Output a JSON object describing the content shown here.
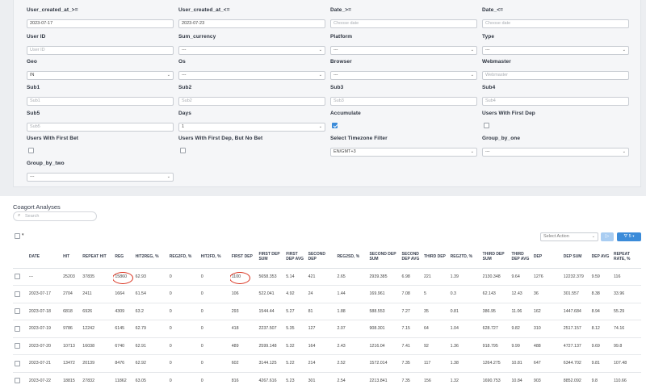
{
  "filters": [
    {
      "id": "f1",
      "label": "User_created_at_>=",
      "value": "2023-07-17",
      "placeholder": "",
      "kind": "text"
    },
    {
      "id": "f2",
      "label": "User_created_at_<=",
      "value": "2023-07-23",
      "placeholder": "",
      "kind": "text"
    },
    {
      "id": "f3",
      "label": "Date_>=",
      "value": "",
      "placeholder": "Choose date",
      "kind": "text"
    },
    {
      "id": "f4",
      "label": "Date_<=",
      "value": "",
      "placeholder": "Choose date",
      "kind": "text"
    },
    {
      "id": "f5",
      "label": "User ID",
      "value": "",
      "placeholder": "User ID",
      "kind": "text"
    },
    {
      "id": "f6",
      "label": "Sum_currency",
      "value": "---",
      "placeholder": "",
      "kind": "select"
    },
    {
      "id": "f7",
      "label": "Platform",
      "value": "---",
      "placeholder": "",
      "kind": "select"
    },
    {
      "id": "f8",
      "label": "Type",
      "value": "---",
      "placeholder": "",
      "kind": "select"
    },
    {
      "id": "f9",
      "label": "Geo",
      "value": "IN",
      "placeholder": "",
      "kind": "select"
    },
    {
      "id": "f10",
      "label": "Os",
      "value": "---",
      "placeholder": "",
      "kind": "select"
    },
    {
      "id": "f11",
      "label": "Browser",
      "value": "---",
      "placeholder": "",
      "kind": "select"
    },
    {
      "id": "f12",
      "label": "Webmaster",
      "value": "",
      "placeholder": "Webmaster",
      "kind": "text"
    },
    {
      "id": "f13",
      "label": "Sub1",
      "value": "",
      "placeholder": "Sub1",
      "kind": "text"
    },
    {
      "id": "f14",
      "label": "Sub2",
      "value": "",
      "placeholder": "Sub2",
      "kind": "text"
    },
    {
      "id": "f15",
      "label": "Sub3",
      "value": "",
      "placeholder": "Sub3",
      "kind": "text"
    },
    {
      "id": "f16",
      "label": "Sub4",
      "value": "",
      "placeholder": "Sub4",
      "kind": "text"
    },
    {
      "id": "f17",
      "label": "Sub5",
      "value": "",
      "placeholder": "Sub5",
      "kind": "text"
    },
    {
      "id": "f18",
      "label": "Days",
      "value": "1",
      "placeholder": "",
      "kind": "select"
    },
    {
      "id": "f19",
      "label": "Accumulate",
      "checked": true,
      "kind": "checkbox"
    },
    {
      "id": "f20",
      "label": "Users With First Dep",
      "checked": false,
      "kind": "checkbox"
    },
    {
      "id": "f21",
      "label": "Users With First Bet",
      "checked": false,
      "kind": "checkbox"
    },
    {
      "id": "f22",
      "label": "Users With First Dep, But No Bet",
      "checked": false,
      "kind": "checkbox"
    },
    {
      "id": "f23",
      "label": "Select Timezone Filter",
      "value": "EN/GMT+3",
      "placeholder": "",
      "kind": "select"
    },
    {
      "id": "f24",
      "label": "Group_by_one",
      "value": "---",
      "placeholder": "",
      "kind": "select"
    },
    {
      "id": "f25",
      "label": "Group_by_two",
      "value": "---",
      "placeholder": "",
      "kind": "select"
    }
  ],
  "section": {
    "title": "Coagort Analyses",
    "search_placeholder": "Search"
  },
  "toolbar": {
    "select_action": "Select Action",
    "run_icon": "▷",
    "filter_label": "5"
  },
  "highlight_color": "#d9301c",
  "table": {
    "columns": [
      "DATE",
      "HIT",
      "REPEAT HIT",
      "REG",
      "HIT2REG, %",
      "REG2FD, %",
      "HIT2FD, %",
      "FIRST DEP",
      "FIRST DEP SUM",
      "FIRST DEP AVG",
      "SECOND DEP",
      "REG2SD, %",
      "SECOND DEP SUM",
      "SECOND DEP AVG",
      "THIRD DEP",
      "REG2TD, %",
      "THIRD DEP SUM",
      "THIRD DEP AVG",
      "DEP",
      "DEP SUM",
      "DEP AVG",
      "REPEAT RATE, %"
    ],
    "rows": [
      [
        "---",
        "25203",
        "37835",
        "15860",
        "62.93",
        "0",
        "0",
        "1100",
        "5658.353",
        "5.14",
        "421",
        "2.65",
        "2939.385",
        "6.98",
        "221",
        "1.39",
        "2130.348",
        "9.64",
        "1276",
        "12232.379",
        "9.59",
        "116"
      ],
      [
        "2023-07-17",
        "2704",
        "2411",
        "1664",
        "61.54",
        "0",
        "0",
        "106",
        "522.041",
        "4.92",
        "24",
        "1.44",
        "169.961",
        "7.08",
        "5",
        "0.3",
        "62.143",
        "12.43",
        "36",
        "301.557",
        "8.38",
        "33.96"
      ],
      [
        "2023-07-18",
        "6818",
        "6926",
        "4309",
        "63.2",
        "0",
        "0",
        "293",
        "1544.44",
        "5.27",
        "81",
        "1.88",
        "588.553",
        "7.27",
        "35",
        "0.81",
        "386.95",
        "11.06",
        "162",
        "1447.684",
        "8.94",
        "55.29"
      ],
      [
        "2023-07-19",
        "9786",
        "12242",
        "6145",
        "62.79",
        "0",
        "0",
        "418",
        "2237.507",
        "5.35",
        "127",
        "2.07",
        "908.301",
        "7.15",
        "64",
        "1.04",
        "628.727",
        "9.82",
        "310",
        "2517.157",
        "8.12",
        "74.16"
      ],
      [
        "2023-07-20",
        "10713",
        "16038",
        "6740",
        "62.91",
        "0",
        "0",
        "489",
        "2599.148",
        "5.32",
        "164",
        "2.43",
        "1216.04",
        "7.41",
        "92",
        "1.36",
        "918.795",
        "9.99",
        "488",
        "4727.137",
        "9.69",
        "99.8"
      ],
      [
        "2023-07-21",
        "13472",
        "20139",
        "8476",
        "62.92",
        "0",
        "0",
        "602",
        "3144.125",
        "5.22",
        "214",
        "2.52",
        "1572.014",
        "7.35",
        "117",
        "1.38",
        "1264.275",
        "10.81",
        "647",
        "6344.702",
        "9.81",
        "107.48"
      ],
      [
        "2023-07-22",
        "18815",
        "27832",
        "11862",
        "63.05",
        "0",
        "0",
        "816",
        "4267.616",
        "5.23",
        "301",
        "2.54",
        "2213.841",
        "7.35",
        "156",
        "1.32",
        "1690.753",
        "10.84",
        "903",
        "8852.092",
        "9.8",
        "110.66"
      ]
    ]
  }
}
